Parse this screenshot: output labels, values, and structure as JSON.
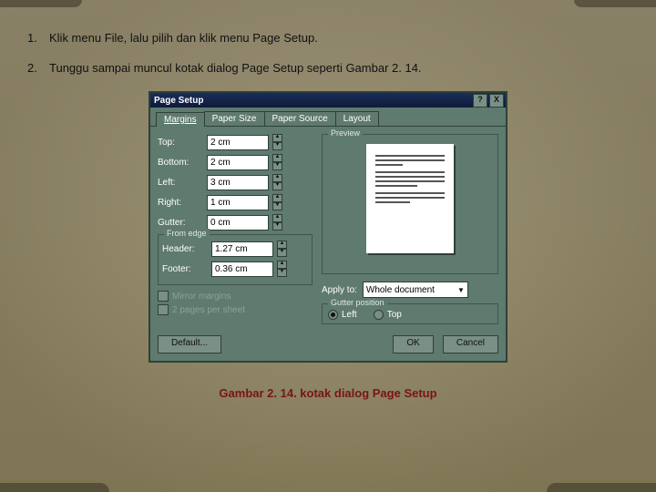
{
  "steps": {
    "s1_num": "1.",
    "s1_text": "Klik menu File, lalu pilih dan klik menu Page Setup.",
    "s2_num": "2.",
    "s2_text": "Tunggu sampai muncul kotak dialog Page Setup seperti Gambar 2. 14."
  },
  "dialog": {
    "title": "Page Setup",
    "help_btn": "?",
    "close_btn": "X",
    "tabs": {
      "margins": "Margins",
      "paper_size": "Paper Size",
      "paper_source": "Paper Source",
      "layout": "Layout"
    },
    "fields": {
      "top_label": "Top:",
      "top_value": "2 cm",
      "bottom_label": "Bottom:",
      "bottom_value": "2 cm",
      "left_label": "Left:",
      "left_value": "3 cm",
      "right_label": "Right:",
      "right_value": "1 cm",
      "gutter_label": "Gutter:",
      "gutter_value": "0 cm"
    },
    "from_edge": {
      "group": "From edge",
      "header_label": "Header:",
      "header_value": "1.27 cm",
      "footer_label": "Footer:",
      "footer_value": "0.36 cm"
    },
    "mirror": "Mirror margins",
    "two_pages": "2 pages per sheet",
    "preview_label": "Preview",
    "apply_label": "Apply to:",
    "apply_value": "Whole document",
    "gutter_pos": {
      "group": "Gutter position",
      "left": "Left",
      "top": "Top"
    },
    "default_btn": "Default...",
    "ok_btn": "OK",
    "cancel_btn": "Cancel"
  },
  "caption": "Gambar 2. 14. kotak dialog Page Setup"
}
